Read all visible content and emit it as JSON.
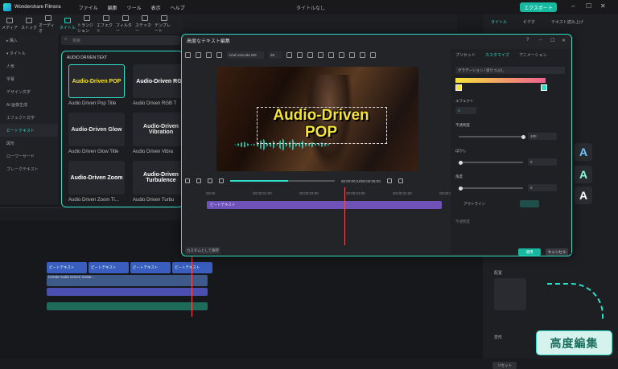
{
  "app": {
    "name": "Wondershare Filmora",
    "doc_title": "タイトルなし",
    "export": "エクスポート"
  },
  "menu": [
    "ファイル",
    "編集",
    "ツール",
    "表示",
    "ヘルプ"
  ],
  "toolbar": [
    {
      "label": "メディア",
      "active": false
    },
    {
      "label": "ストック",
      "active": false
    },
    {
      "label": "オーディオ",
      "active": false
    },
    {
      "label": "タイトル",
      "active": true
    },
    {
      "label": "トランジション",
      "active": false
    },
    {
      "label": "エフェクト",
      "active": false
    },
    {
      "label": "フィルター",
      "active": false
    },
    {
      "label": "ステッカー",
      "active": false
    },
    {
      "label": "テンプレート",
      "active": false
    }
  ],
  "sidebar": [
    {
      "label": "▸ 購入",
      "sel": false
    },
    {
      "label": "▾ タイトル",
      "sel": false
    },
    {
      "label": "人気",
      "sel": false
    },
    {
      "label": "字幕",
      "sel": false
    },
    {
      "label": "デザイン文字",
      "sel": false
    },
    {
      "label": "AI 画像生成",
      "sel": false
    },
    {
      "label": "エフェクト文字",
      "sel": false
    },
    {
      "label": "ビートテキスト",
      "sel": true
    },
    {
      "label": "図形",
      "sel": false
    },
    {
      "label": "ローワーサード",
      "sel": false
    },
    {
      "label": "ブレークテキスト",
      "sel": false
    }
  ],
  "search_placeholder": "検索",
  "gallery": {
    "category": "AUDIO DRIVEN TEXT",
    "cards": [
      {
        "art": "Audio-Driven POP",
        "label": "Audio Driven Pop Title",
        "color": "#f5e33a"
      },
      {
        "art": "Audio-Driven RGB",
        "label": "Audio Driven RGB T",
        "color": "#ffffff"
      },
      {
        "art": "Audio-Driven Glow",
        "label": "Audio Driven Glow Title",
        "color": "#e8e8e8"
      },
      {
        "art": "Audio-Driven Vibration",
        "label": "Audio Driven Vibra",
        "color": "#e8e8e8"
      },
      {
        "art": "Audio-Driven Zoom",
        "label": "Audio Driven Zoom Ti...",
        "color": "#ffffff"
      },
      {
        "art": "Audio-Driven Turbulence",
        "label": "Audio Driven Turbu",
        "color": "#ffffff"
      }
    ]
  },
  "right_tabs": [
    "タイトル",
    "ビデオ",
    "テキスト読み上げ"
  ],
  "dialog": {
    "title": "高度なテキスト編集",
    "font": "Arial Unicode MS",
    "size": "28",
    "canvas_text_line1": "Audio-Driven",
    "canvas_text_line2": "POP",
    "timecode": "00:00:00:24/00:00:05:00",
    "ruler": [
      "00:00",
      "00:00:01:00",
      "00:00:02:00",
      "00:00:03:00",
      "00:00:04:00",
      "00:00:05:00"
    ],
    "track_label": "ビートテキスト",
    "save_custom": "カスタムとして保存",
    "settings_tabs": [
      "プリセット",
      "カスタマイズ",
      "アニメーション"
    ],
    "gradient_label": "グラデーション / 塗りつぶし",
    "effect_label": "エフェクト",
    "opacity_label": "不透明度",
    "opacity": "100",
    "blur_label": "ぼかし",
    "blur": "0",
    "angle_label": "角度",
    "angle": "0",
    "outline_label": "アウトライン",
    "outline_opacity_label": "不透明度",
    "ok": "適用",
    "cancel": "キャンセル"
  },
  "timeline_clips": [
    "ビートテキスト",
    "ビートテキスト",
    "ビートテキスト",
    "ビートテキスト"
  ],
  "video_clip": "Create Audio Driven Guitar...",
  "right_bottom": {
    "pos_label": "配置",
    "anim_label": "変形",
    "reset": "リセット",
    "btn": "適用"
  },
  "advanced_badge": "高度編集"
}
